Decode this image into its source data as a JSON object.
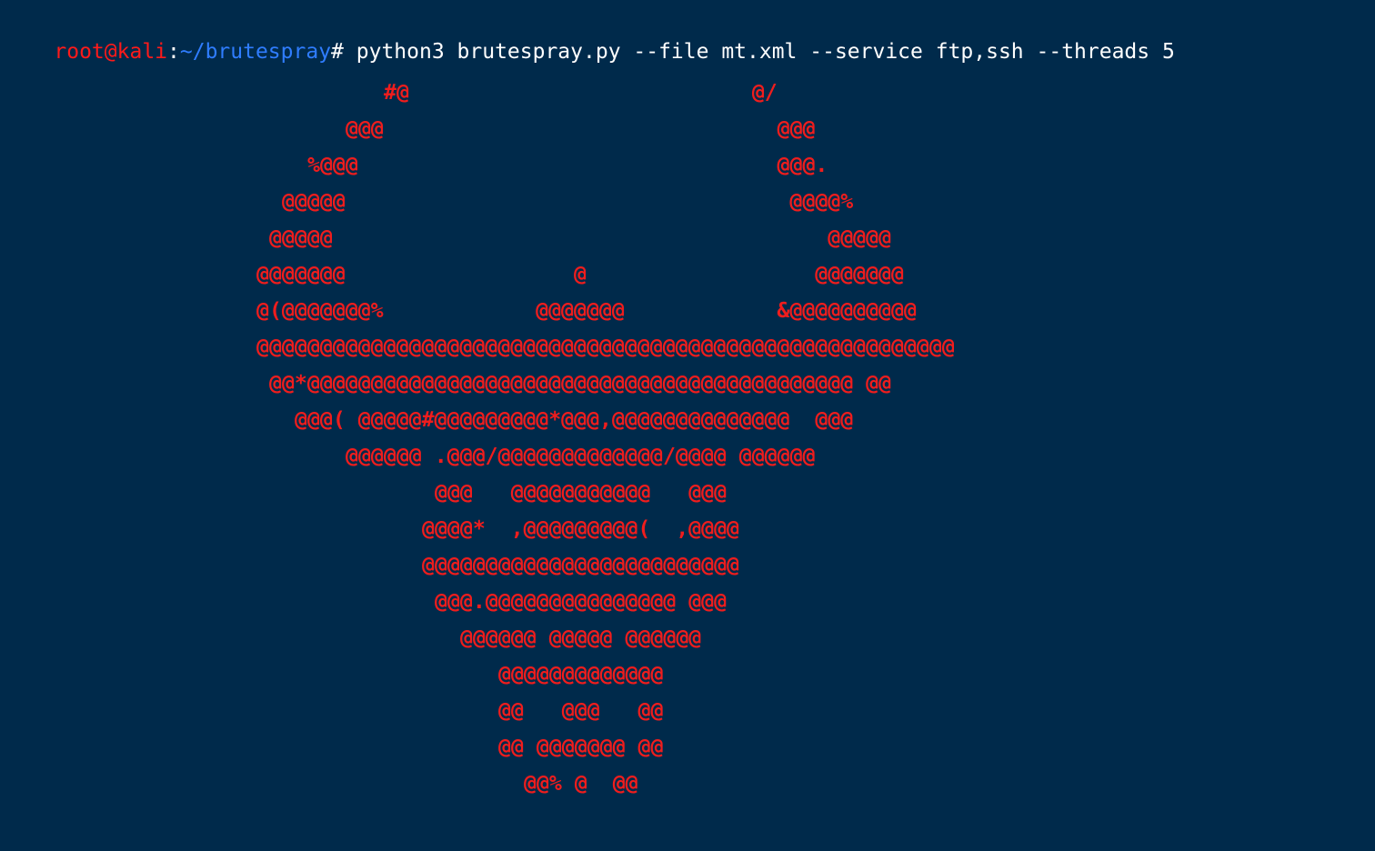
{
  "terminal": {
    "prompt": {
      "user_host": "root@kali",
      "separator": ":",
      "path": "~/brutespray",
      "symbol": "#",
      "command": " python3 brutespray.py --file mt.xml --service ftp,ssh --threads 5"
    },
    "banner_lines": [
      "#@                           @/",
      "@@@                               @@@",
      "%@@@                                 @@@.",
      "@@@@@                                   @@@@%",
      "@@@@@                                       @@@@@",
      "@@@@@@@                  @                  @@@@@@@",
      "@(@@@@@@@%            @@@@@@@            &@@@@@@@@@@",
      "@@@@@@@@@@@@@@@@@@@@@@@@@@@@@@@@@@@@@@@@@@@@@@@@@@@@@@@",
      "@@*@@@@@@@@@@@@@@@@@@@@@@@@@@@@@@@@@@@@@@@@@@@ @@",
      "@@@( @@@@@#@@@@@@@@@*@@@,@@@@@@@@@@@@@@  @@@",
      "@@@@@@ .@@@/@@@@@@@@@@@@@/@@@@ @@@@@@",
      "@@@   @@@@@@@@@@@   @@@",
      "@@@@*  ,@@@@@@@@@(  ,@@@@",
      "@@@@@@@@@@@@@@@@@@@@@@@@@",
      "@@@.@@@@@@@@@@@@@@@ @@@",
      "@@@@@@ @@@@@ @@@@@@",
      "@@@@@@@@@@@@@",
      "@@   @@@   @@",
      "@@ @@@@@@@ @@",
      "@@% @  @@"
    ]
  }
}
